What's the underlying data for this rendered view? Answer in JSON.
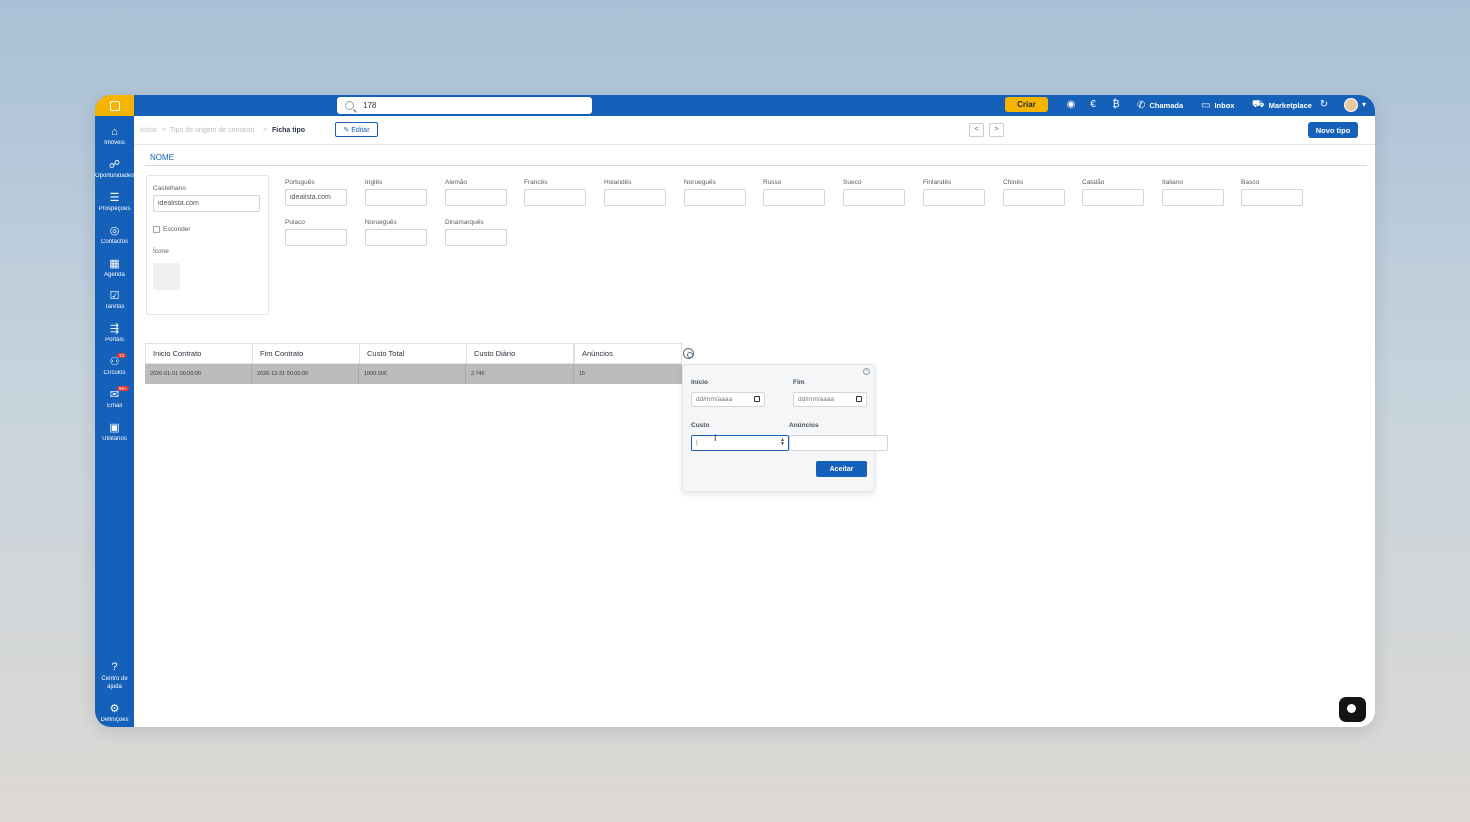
{
  "topbar": {
    "search_value": "178",
    "criar_label": "Criar",
    "chamada_label": "Chamada",
    "inbox_label": "Inbox",
    "marketplace_label": "Marketplace"
  },
  "sidebar": {
    "items": [
      {
        "label": "Imóveis",
        "icon": "house-icon"
      },
      {
        "label": "Oportunidades",
        "icon": "people-icon"
      },
      {
        "label": "Prospeções",
        "icon": "list-icon"
      },
      {
        "label": "Contactos",
        "icon": "contact-icon"
      },
      {
        "label": "Agenda",
        "icon": "calendar-icon"
      },
      {
        "label": "Tarefas",
        "icon": "checklist-icon"
      },
      {
        "label": "Portais",
        "icon": "portal-icon"
      },
      {
        "label": "Círculos",
        "icon": "circles-icon",
        "badge": "13"
      },
      {
        "label": "Email",
        "icon": "mail-icon",
        "badge": "99+"
      },
      {
        "label": "Utilitários",
        "icon": "briefcase-icon"
      },
      {
        "label": "Centro de ajuda",
        "icon": "help-icon"
      },
      {
        "label": "Definições",
        "icon": "gear-icon"
      }
    ]
  },
  "breadcrumb": {
    "items": [
      "Início",
      "Tipo de origem de contacto",
      "Ficha tipo"
    ],
    "edit_label": "✎ Editar"
  },
  "header": {
    "prev_label": "<",
    "next_label": ">",
    "new_type_label": "Novo tipo"
  },
  "section": {
    "title": "NOME"
  },
  "form": {
    "main_label": "Castelhano",
    "main_value": "idealista.com",
    "hide_label": "Esconder",
    "icon_label": "Ícone",
    "languages": [
      {
        "label": "Português",
        "value": "idealista.com"
      },
      {
        "label": "Inglês",
        "value": ""
      },
      {
        "label": "Alemão",
        "value": ""
      },
      {
        "label": "Francês",
        "value": ""
      },
      {
        "label": "Holandês",
        "value": ""
      },
      {
        "label": "Norueguês",
        "value": ""
      },
      {
        "label": "Russo",
        "value": ""
      },
      {
        "label": "Sueco",
        "value": ""
      },
      {
        "label": "Finlandês",
        "value": ""
      },
      {
        "label": "Chinês",
        "value": ""
      },
      {
        "label": "Catalão",
        "value": ""
      },
      {
        "label": "Italiano",
        "value": ""
      },
      {
        "label": "Basco",
        "value": ""
      },
      {
        "label": "Polaco",
        "value": ""
      },
      {
        "label": "Norueguês",
        "value": ""
      },
      {
        "label": "Dinamarquês",
        "value": ""
      }
    ]
  },
  "table": {
    "headers": [
      "Inicio Contrato",
      "Fim Contrato",
      "Custo Total",
      "Custo Diário",
      "Anúncios"
    ],
    "rows": [
      [
        "2026-01-01 00:00:00",
        "2026-12-31 00:00:00",
        "1000.00€",
        "2.74€",
        "15"
      ]
    ]
  },
  "popup": {
    "inicio_label": "Início",
    "inicio_placeholder": "dd/mm/aaaa",
    "fim_label": "Fim",
    "fim_placeholder": "dd/mm/aaaa",
    "custo_label": "Custo",
    "custo_value": "|",
    "anuncios_label": "Anúncios",
    "anuncios_value": "",
    "accept_label": "Aceitar"
  },
  "colors": {
    "brand_blue": "#1560b8",
    "accent_yellow": "#f5b400"
  }
}
